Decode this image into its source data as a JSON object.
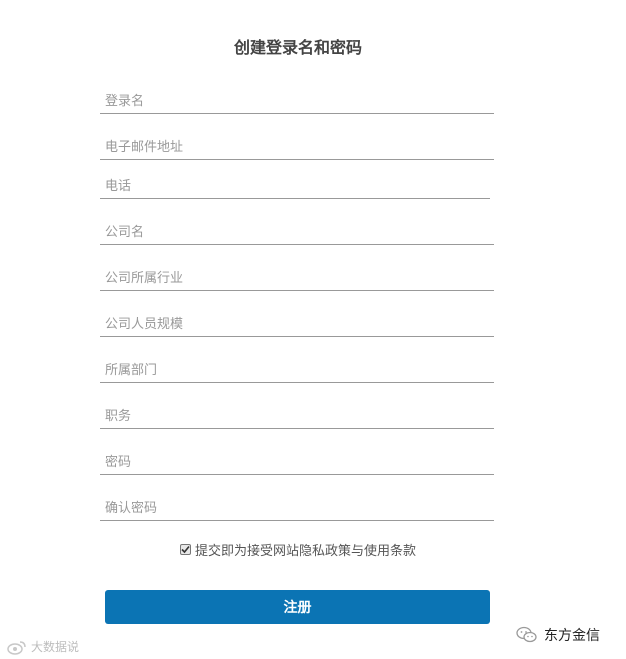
{
  "form": {
    "title": "创建登录名和密码",
    "fields": [
      {
        "placeholder": "登录名",
        "value": ""
      },
      {
        "placeholder": "电子邮件地址",
        "value": ""
      },
      {
        "placeholder": "电话",
        "value": ""
      },
      {
        "placeholder": "公司名",
        "value": ""
      },
      {
        "placeholder": "公司所属行业",
        "value": ""
      },
      {
        "placeholder": "公司人员规模",
        "value": ""
      },
      {
        "placeholder": "所属部门",
        "value": ""
      },
      {
        "placeholder": "职务",
        "value": ""
      },
      {
        "placeholder": "密码",
        "value": ""
      },
      {
        "placeholder": "确认密码",
        "value": ""
      }
    ],
    "agreement_label": "提交即为接受网站隐私政策与使用条款",
    "agreement_checked": true,
    "submit_label": "注册"
  },
  "watermarks": {
    "left_text": "大数据说",
    "right_text": "东方金信"
  },
  "colors": {
    "accent": "#0b74b4",
    "field_underline": "#999999",
    "placeholder": "#999999"
  }
}
